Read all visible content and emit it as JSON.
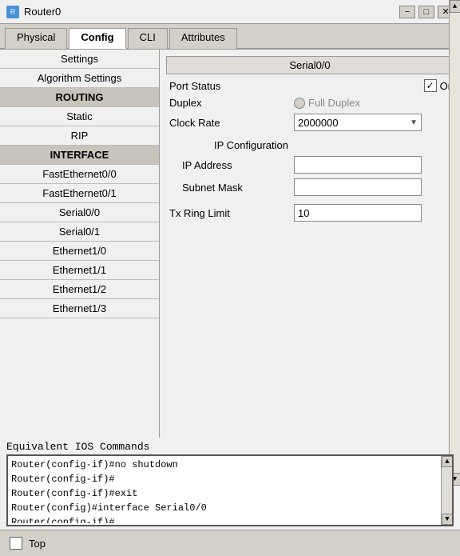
{
  "titlebar": {
    "title": "Router0",
    "icon": "R",
    "minimize": "−",
    "maximize": "□",
    "close": "✕"
  },
  "tabs": [
    {
      "label": "Physical",
      "active": false
    },
    {
      "label": "Config",
      "active": true
    },
    {
      "label": "CLI",
      "active": false
    },
    {
      "label": "Attributes",
      "active": false
    }
  ],
  "sidebar": {
    "items": [
      {
        "label": "Settings",
        "type": "normal"
      },
      {
        "label": "Algorithm Settings",
        "type": "normal"
      },
      {
        "label": "ROUTING",
        "type": "header"
      },
      {
        "label": "Static",
        "type": "normal"
      },
      {
        "label": "RIP",
        "type": "normal"
      },
      {
        "label": "INTERFACE",
        "type": "header"
      },
      {
        "label": "FastEthernet0/0",
        "type": "normal"
      },
      {
        "label": "FastEthernet0/1",
        "type": "normal"
      },
      {
        "label": "Serial0/0",
        "type": "normal"
      },
      {
        "label": "Serial0/1",
        "type": "normal"
      },
      {
        "label": "Ethernet1/0",
        "type": "normal"
      },
      {
        "label": "Ethernet1/1",
        "type": "normal"
      },
      {
        "label": "Ethernet1/2",
        "type": "normal"
      },
      {
        "label": "Ethernet1/3",
        "type": "normal"
      }
    ]
  },
  "panel": {
    "title": "Serial0/0",
    "port_status_label": "Port Status",
    "port_status_checked": true,
    "port_status_on": "On",
    "duplex_label": "Duplex",
    "duplex_value": "Full Duplex",
    "clock_rate_label": "Clock Rate",
    "clock_rate_value": "2000000",
    "ip_config_label": "IP Configuration",
    "ip_address_label": "IP Address",
    "ip_address_value": "",
    "subnet_mask_label": "Subnet Mask",
    "subnet_mask_value": "",
    "tx_ring_limit_label": "Tx Ring Limit",
    "tx_ring_limit_value": "10"
  },
  "ios_commands": {
    "label": "Equivalent IOS Commands",
    "lines": [
      "Router(config-if)#no shutdown",
      "Router(config-if)#",
      "Router(config-if)#exit",
      "Router(config)#interface Serial0/0",
      "Router(config-if)#"
    ]
  },
  "footer": {
    "top_checkbox_checked": false,
    "top_label": "Top"
  }
}
